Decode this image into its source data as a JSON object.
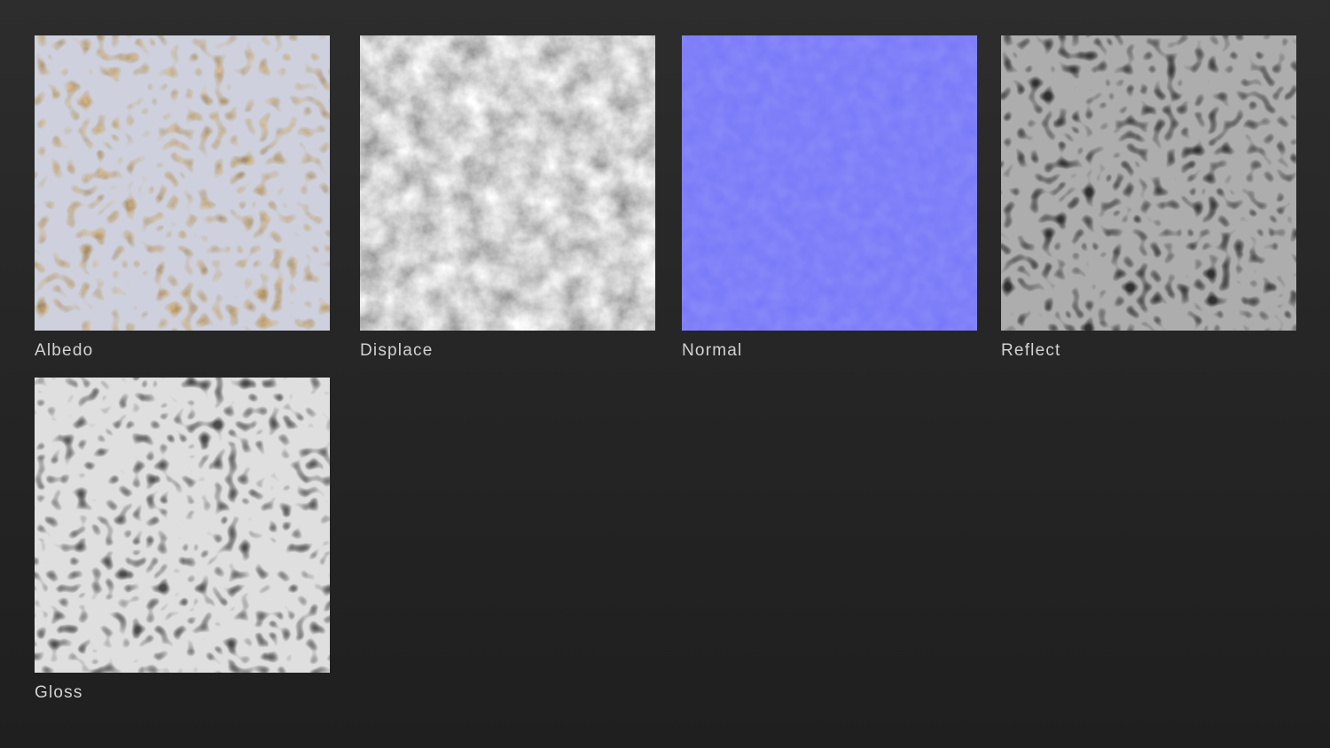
{
  "maps": [
    {
      "label": "Albedo",
      "color": "#a58a5e"
    },
    {
      "label": "Displace",
      "color": "#b8b8b8"
    },
    {
      "label": "Normal",
      "color": "#7b7cfb"
    },
    {
      "label": "Reflect",
      "color": "#585858"
    },
    {
      "label": "Gloss",
      "color": "#9c9c9c"
    }
  ]
}
